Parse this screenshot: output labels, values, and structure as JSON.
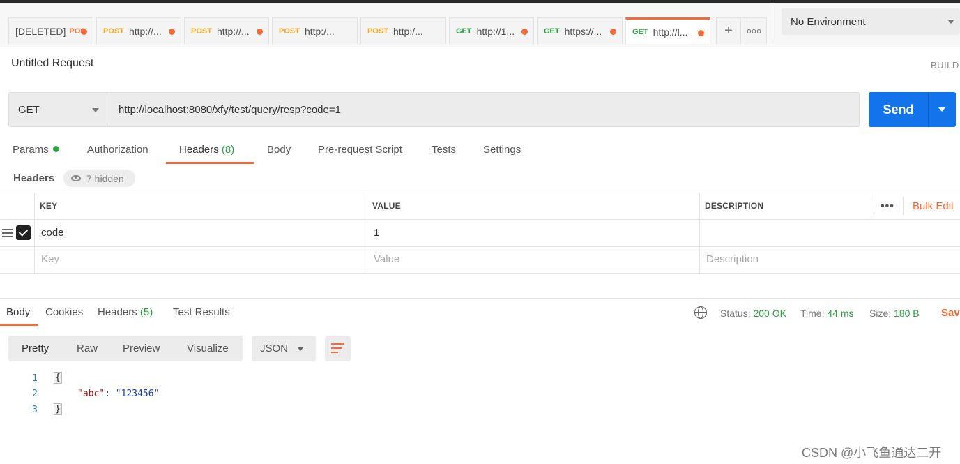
{
  "tabs": [
    {
      "method": "",
      "label": "[DELETED]",
      "extra": "POS"
    },
    {
      "method": "POST",
      "label": "http://..."
    },
    {
      "method": "POST",
      "label": "http://..."
    },
    {
      "method": "POST",
      "label": "http:/..."
    },
    {
      "method": "POST",
      "label": "http:/..."
    },
    {
      "method": "GET",
      "label": "http://1..."
    },
    {
      "method": "GET",
      "label": "https://..."
    },
    {
      "method": "GET",
      "label": "http://l..."
    }
  ],
  "tab_controls": {
    "add": "+",
    "more": "ooo"
  },
  "environment": {
    "selected": "No Environment"
  },
  "request": {
    "title": "Untitled Request",
    "build_label": "BUILD",
    "method": "GET",
    "url": "http://localhost:8080/xfy/test/query/resp?code=1",
    "send_label": "Send"
  },
  "request_tabs": {
    "params": "Params",
    "authorization": "Authorization",
    "headers": "Headers",
    "headers_count": "(8)",
    "body": "Body",
    "pre_request": "Pre-request Script",
    "tests": "Tests",
    "settings": "Settings"
  },
  "headers_section": {
    "label": "Headers",
    "hidden_text": "7 hidden",
    "columns": {
      "key": "KEY",
      "value": "VALUE",
      "description": "DESCRIPTION"
    },
    "more": "•••",
    "bulk_edit": "Bulk Edit",
    "rows": [
      {
        "key": "code",
        "value": "1",
        "description": ""
      }
    ],
    "placeholders": {
      "key": "Key",
      "value": "Value",
      "description": "Description"
    }
  },
  "response_tabs": {
    "body": "Body",
    "cookies": "Cookies",
    "headers": "Headers",
    "headers_count": "(5)",
    "test_results": "Test Results"
  },
  "response_stats": {
    "status_label": "Status:",
    "status_value": "200 OK",
    "time_label": "Time:",
    "time_value": "44 ms",
    "size_label": "Size:",
    "size_value": "180 B",
    "save": "Sav"
  },
  "view_options": {
    "pretty": "Pretty",
    "raw": "Raw",
    "preview": "Preview",
    "visualize": "Visualize",
    "format": "JSON"
  },
  "response_body": {
    "line_numbers": [
      "1",
      "2",
      "3"
    ],
    "open_brace": "{",
    "key": "\"abc\"",
    "colon": ": ",
    "value": "\"123456\"",
    "close_brace": "}"
  },
  "watermark": "CSDN @小飞鱼通达二开",
  "colors": {
    "accent": "#f26b3a",
    "send": "#1273eb",
    "success": "#2f9e44",
    "post": "#f5a623"
  }
}
